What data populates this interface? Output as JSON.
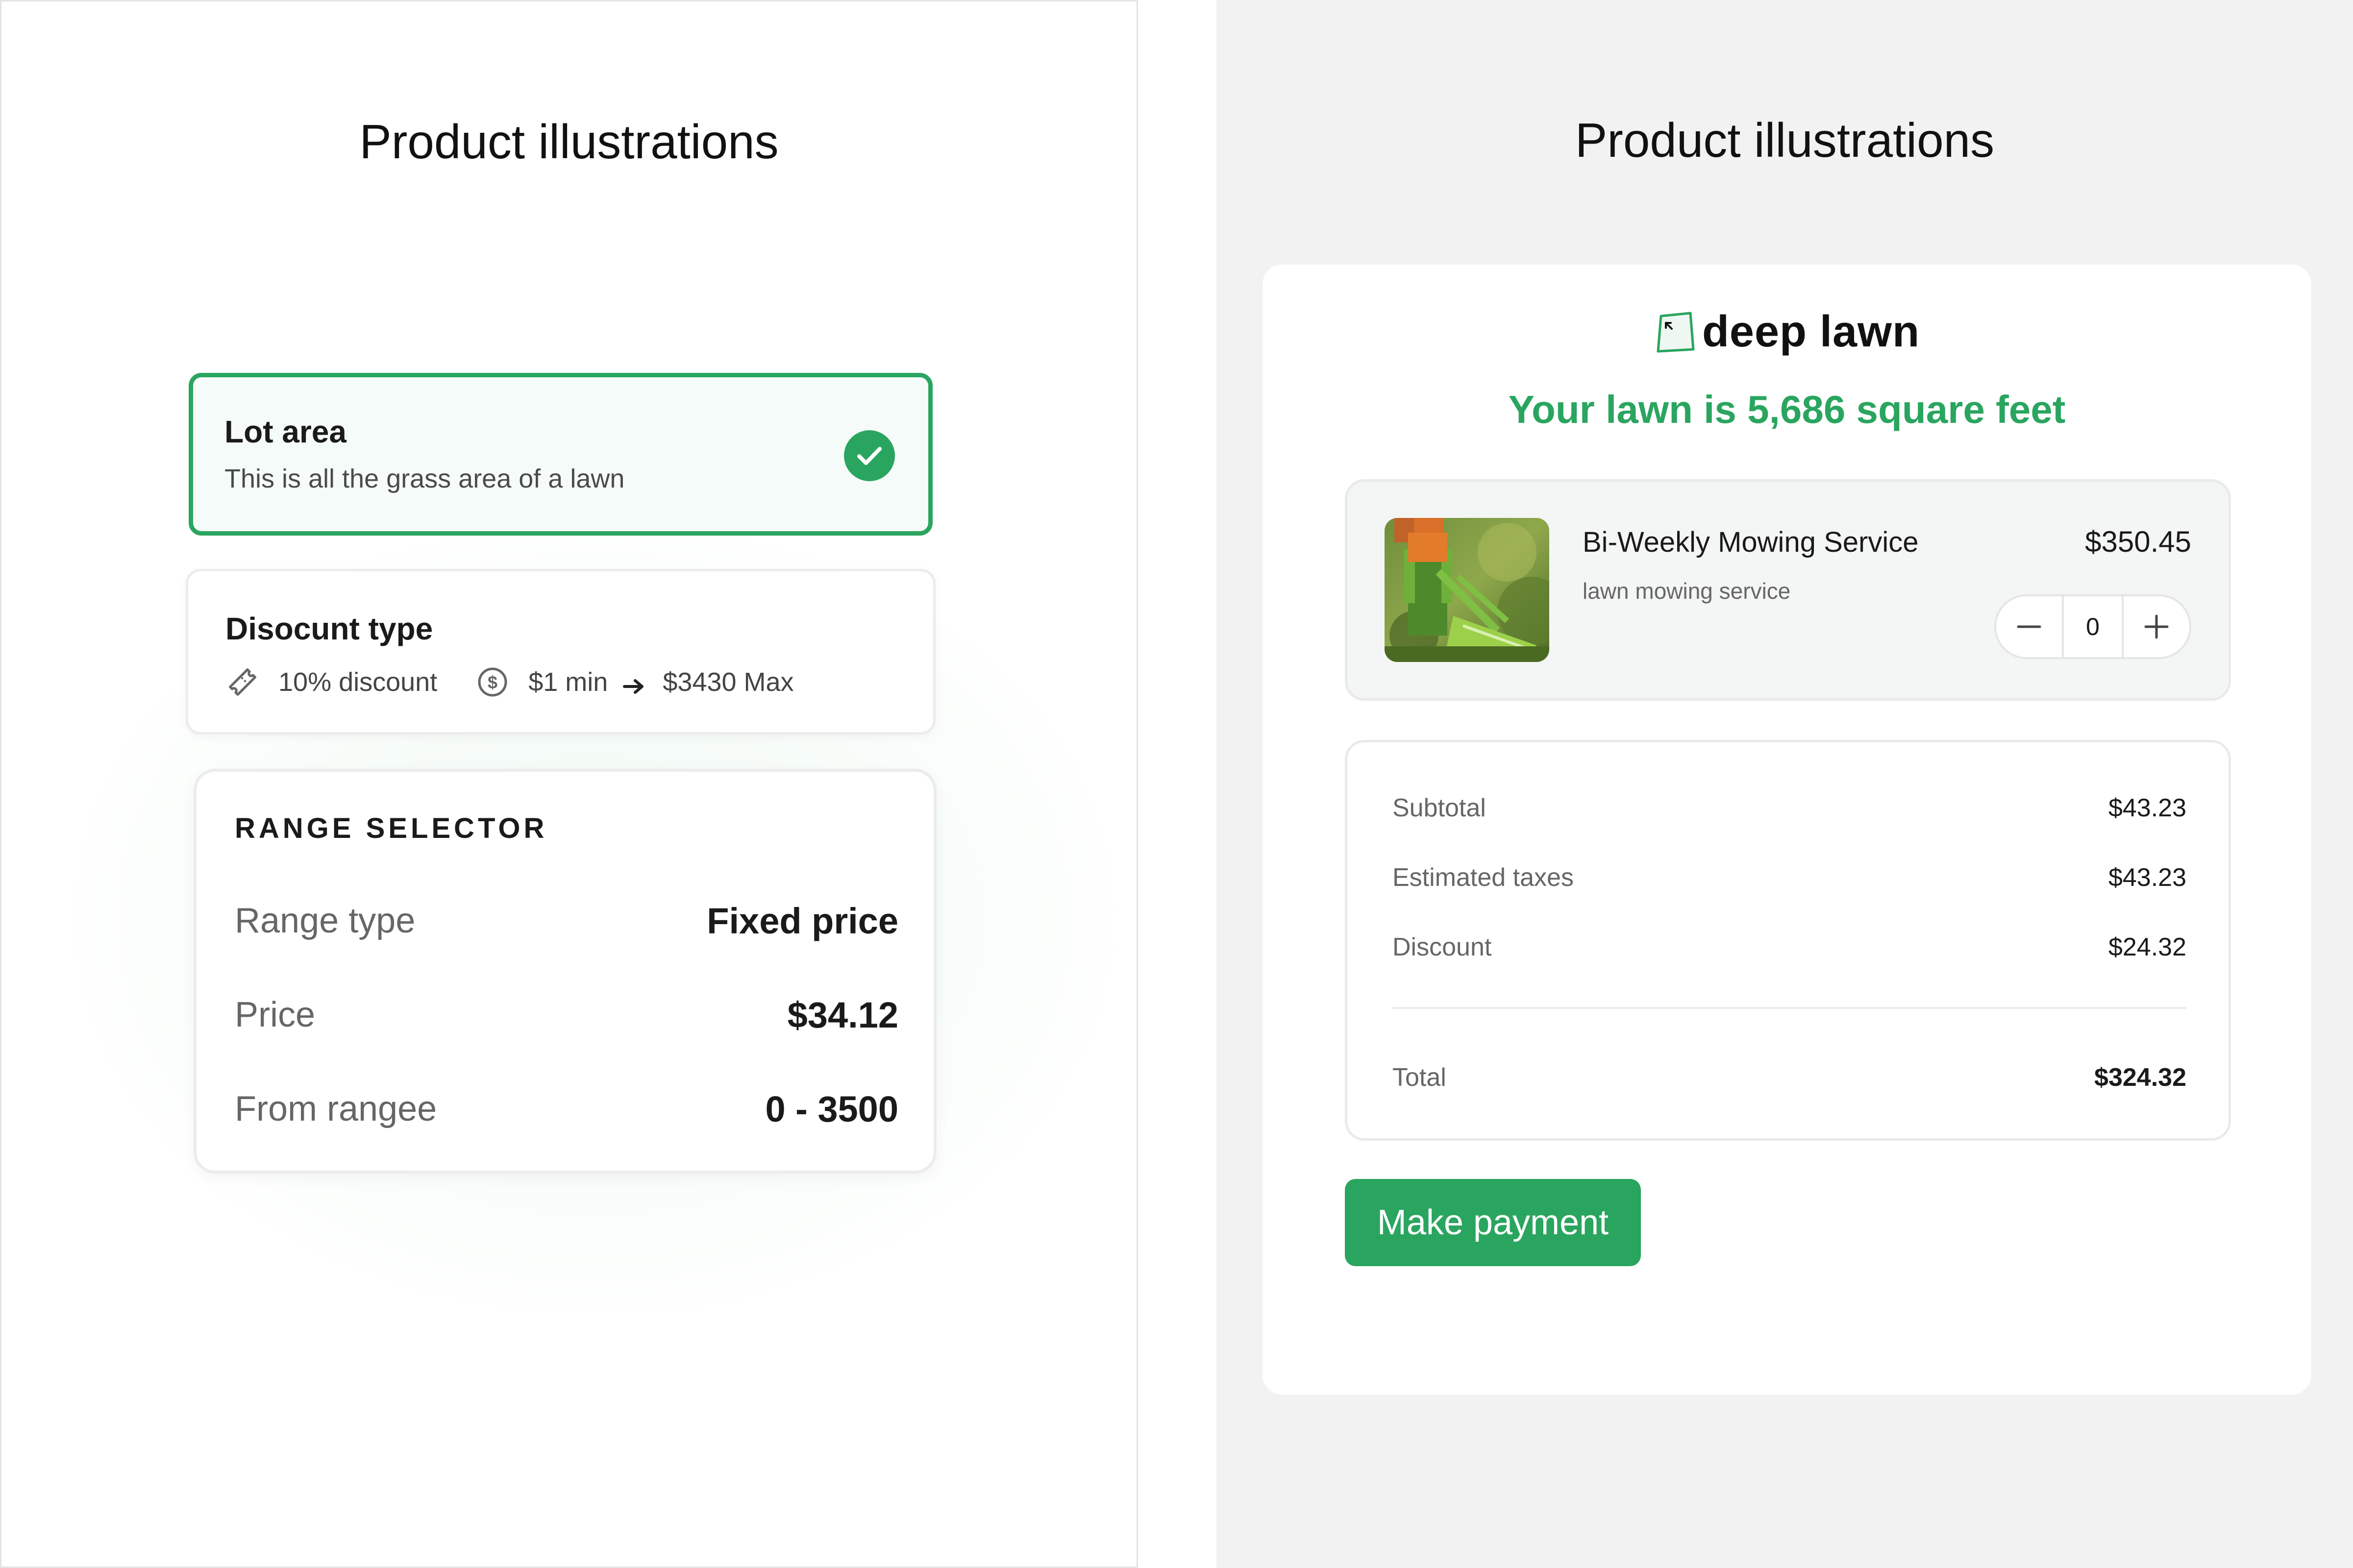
{
  "left": {
    "title": "Product illustrations",
    "lot_card": {
      "title": "Lot area",
      "subtitle": "This is all the grass area of a lawn",
      "selected": true
    },
    "discount_card": {
      "title": "Disocunt type",
      "discount": "10% discount",
      "min": "$1 min",
      "max": "$3430 Max"
    },
    "range_card": {
      "heading": "RANGE SELECTOR",
      "rows": [
        {
          "label": "Range type",
          "value": "Fixed price"
        },
        {
          "label": "Price",
          "value": "$34.12"
        },
        {
          "label": "From rangee",
          "value": "0 - 3500"
        }
      ]
    }
  },
  "right": {
    "title": "Product illustrations",
    "brand": "deep lawn",
    "headline": "Your lawn is 5,686 square feet",
    "product": {
      "name": "Bi-Weekly Mowing Service",
      "description": "lawn mowing service",
      "price": "$350.45",
      "quantity": "0"
    },
    "summary": {
      "rows": [
        {
          "label": "Subtotal",
          "value": "$43.23"
        },
        {
          "label": "Estimated taxes",
          "value": "$43.23"
        },
        {
          "label": "Discount",
          "value": "$24.32"
        }
      ],
      "total_label": "Total",
      "total_value": "$324.32"
    },
    "pay_button": "Make payment"
  },
  "colors": {
    "accent": "#2aa55f",
    "panel_bg": "#f2f2f2",
    "text": "#1a1a1a",
    "muted": "#666666"
  },
  "icons": [
    "check-icon",
    "ticket-icon",
    "dollar-circle-icon",
    "arrow-right-icon",
    "lawn-logo-icon",
    "minus-icon",
    "plus-icon"
  ]
}
